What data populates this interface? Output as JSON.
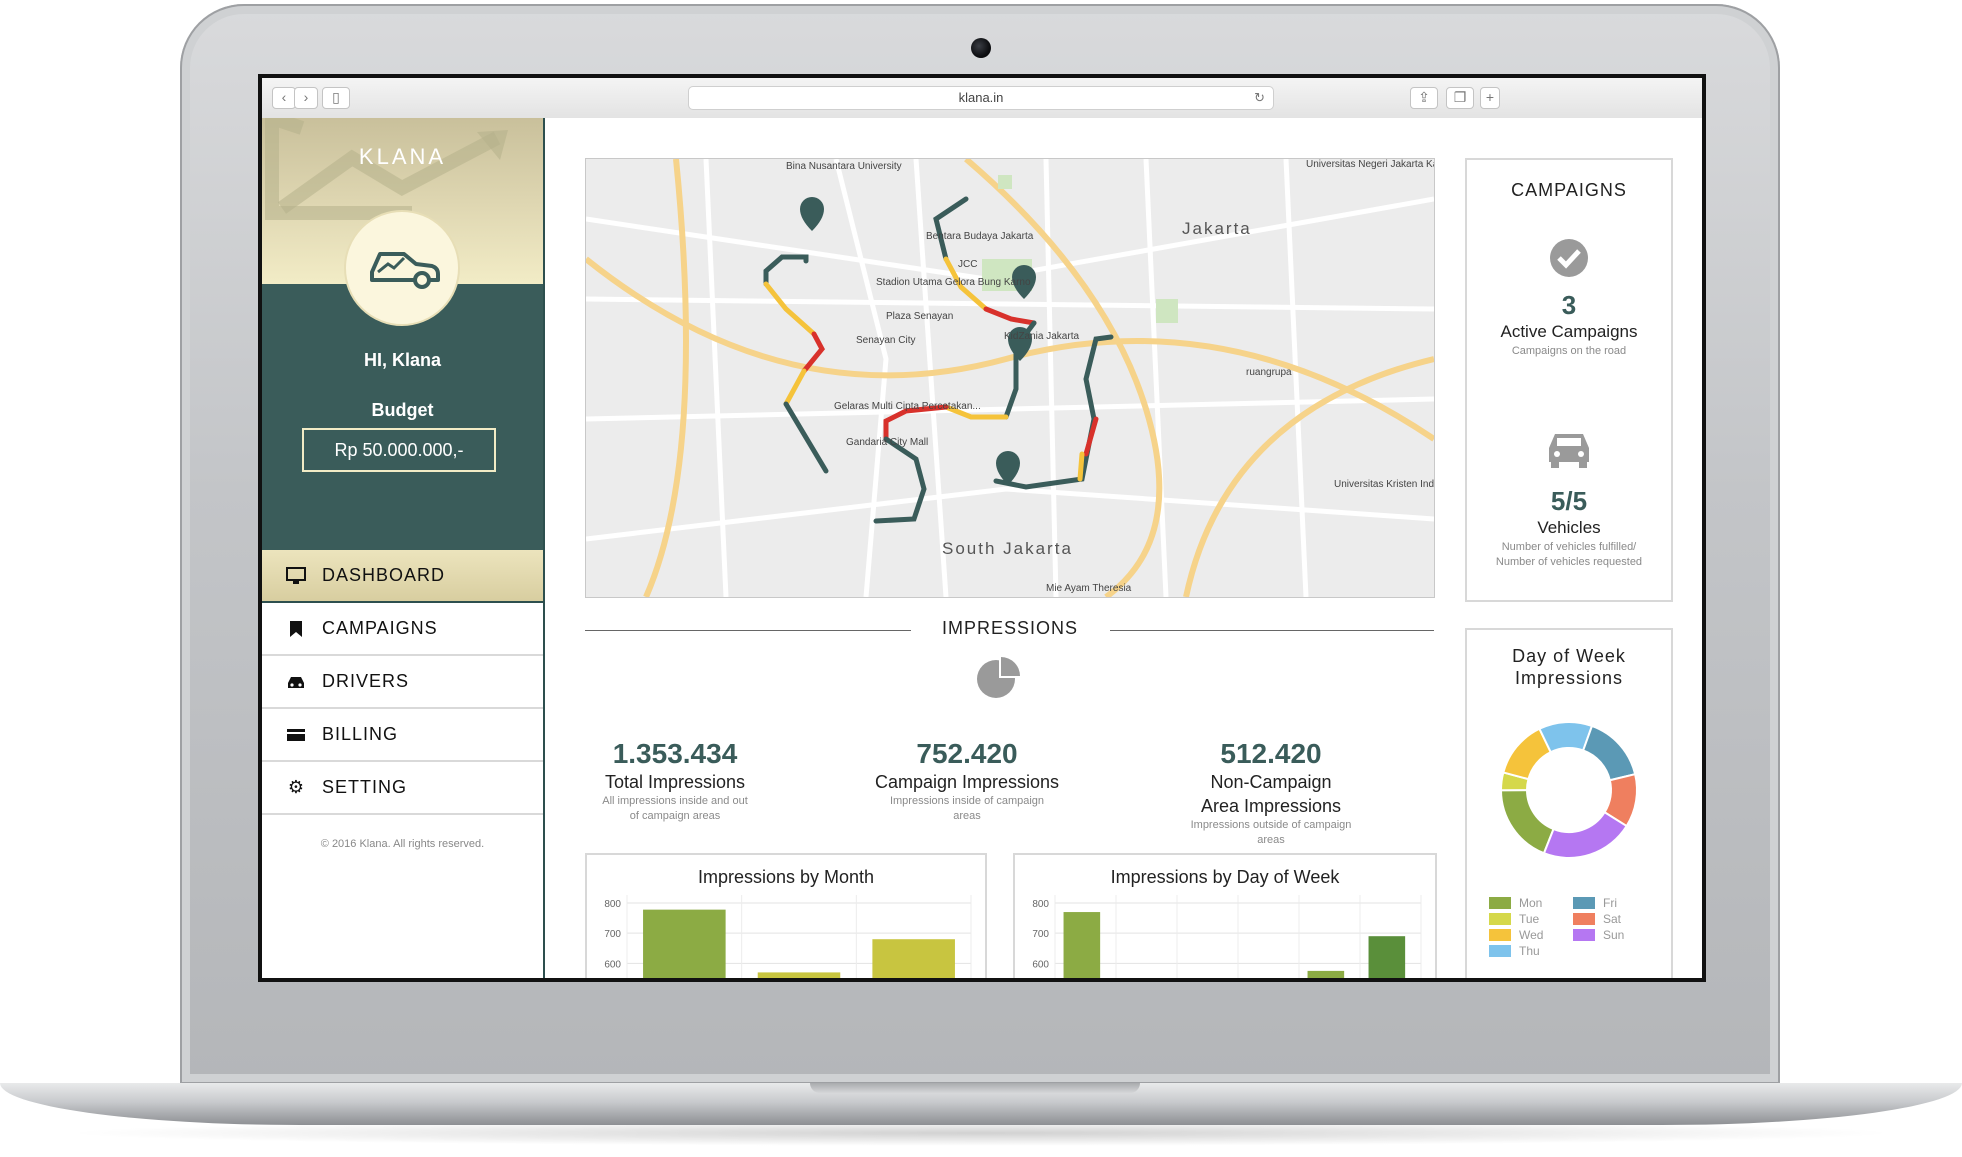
{
  "browser": {
    "url": "klana.in",
    "reload_icon": "reload-icon"
  },
  "sidebar": {
    "logo": "KLANA",
    "greeting": "HI, Klana",
    "budget_label": "Budget",
    "budget_value": "Rp 50.000.000,-",
    "nav": [
      {
        "label": "DASHBOARD",
        "icon": "monitor-icon",
        "active": true
      },
      {
        "label": "CAMPAIGNS",
        "icon": "bookmark-icon",
        "active": false
      },
      {
        "label": "DRIVERS",
        "icon": "car-icon",
        "active": false
      },
      {
        "label": "BILLING",
        "icon": "credit-card-icon",
        "active": false
      },
      {
        "label": "SETTING",
        "icon": "gear-icon",
        "active": false
      }
    ],
    "copyright": "© 2016 Klana. All rights reserved."
  },
  "map": {
    "cities": [
      "Jakarta",
      "South Jakarta"
    ],
    "labels": [
      "Bina Nusantara University",
      "Bentara Budaya Jakarta",
      "Stadion Utama Gelora Bung Karno",
      "JCC",
      "Plaza Senayan",
      "Senayan City",
      "KidZania Jakarta",
      "Gelaras Multi Cipta Percetakan...",
      "Gandaria City Mall",
      "ruangrupa",
      "Universitas Kristen Indonesia",
      "Universitas Negeri Jakarta Kampus",
      "Mie Ayam Theresia"
    ]
  },
  "campaigns": {
    "title": "CAMPAIGNS",
    "active_count": "3",
    "active_label": "Active Campaigns",
    "active_sub": "Campaigns on the road",
    "vehicles_count": "5/5",
    "vehicles_label": "Vehicles",
    "vehicles_sub1": "Number of vehicles fulfilled/",
    "vehicles_sub2": "Number of vehicles requested"
  },
  "impressions": {
    "heading": "IMPRESSIONS",
    "stats": [
      {
        "value": "1.353.434",
        "label1": "Total Impressions",
        "label2": "",
        "sub1": "All impressions inside and out",
        "sub2": "of campaign areas"
      },
      {
        "value": "752.420",
        "label1": "Campaign Impressions",
        "label2": "",
        "sub1": "Impressions inside of campaign",
        "sub2": "areas"
      },
      {
        "value": "512.420",
        "label1": "Non-Campaign",
        "label2": "Area Impressions",
        "sub1": "Impressions outside of campaign",
        "sub2": "areas"
      }
    ]
  },
  "chart_data": [
    {
      "type": "bar",
      "title": "Impressions by Month",
      "yticks": [
        "800",
        "700",
        "600"
      ],
      "ylim_visible": [
        550,
        800
      ],
      "values": [
        778,
        570,
        680
      ],
      "colors": [
        "#8cab44",
        "#c8c540",
        "#c8c540"
      ]
    },
    {
      "type": "bar",
      "title": "Impressions by Day of Week",
      "yticks": [
        "800",
        "700",
        "600"
      ],
      "ylim_visible": [
        550,
        800
      ],
      "values": [
        770,
        575,
        690
      ],
      "colors": [
        "#8cab44",
        "#8cab44",
        "#5a8f3a"
      ]
    },
    {
      "type": "pie",
      "title_line1": "Day of Week",
      "title_line2": "Impressions",
      "categories": [
        "Mon",
        "Tue",
        "Wed",
        "Thu",
        "Fri",
        "Sat",
        "Sun"
      ],
      "values": [
        18,
        4,
        13,
        12,
        15,
        12,
        21
      ],
      "colors": [
        "#8cab44",
        "#d5d84a",
        "#f5c33b",
        "#7ec3ec",
        "#5b99b5",
        "#ef7f5f",
        "#b577f2"
      ]
    }
  ]
}
